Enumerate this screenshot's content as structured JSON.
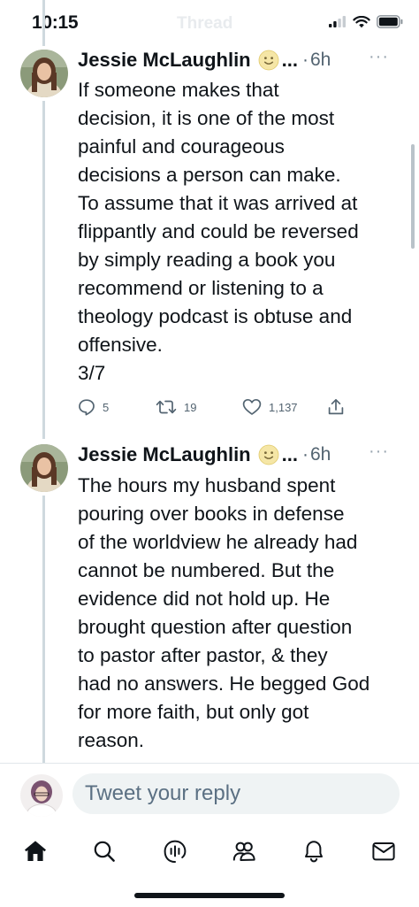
{
  "status_bar": {
    "time": "10:15",
    "header_title_faded": "Thread"
  },
  "tweets": [
    {
      "author": "Jessie McLaughlin",
      "emoji": "slightly-smiling-face-emoji",
      "ellipsis": "...",
      "separator": "·",
      "age": "6h",
      "more": "···",
      "body": "If someone makes that\ndecision, it is one of the most\npainful and courageous\ndecisions a person can make.\nTo assume that it was arrived at\nflippantly and could be reversed\nby simply reading a book you\nrecommend or listening to a\ntheology podcast is obtuse and\noffensive.\n3/7",
      "replies": "5",
      "retweets": "19",
      "likes": "1,137"
    },
    {
      "author": "Jessie McLaughlin",
      "emoji": "slightly-smiling-face-emoji",
      "ellipsis": "...",
      "separator": "·",
      "age": "6h",
      "more": "···",
      "body": "The hours my husband spent\npouring over books in defense\nof the worldview he already had\ncannot be numbered. But the\nevidence did not hold up. He\nbrought question after question\nto pastor after pastor, & they\nhad no answers. He begged God\nfor more faith, but only got\nreason."
    }
  ],
  "reply": {
    "placeholder": "Tweet your reply"
  },
  "tab_bar": {
    "tabs": [
      "home-icon",
      "search-icon",
      "spaces-icon",
      "communities-icon",
      "notifications-icon",
      "messages-icon"
    ]
  },
  "colors": {
    "text": "#0f1419",
    "secondary": "#536471",
    "thread_line": "#cfd9de",
    "reply_box": "#eff3f4"
  }
}
